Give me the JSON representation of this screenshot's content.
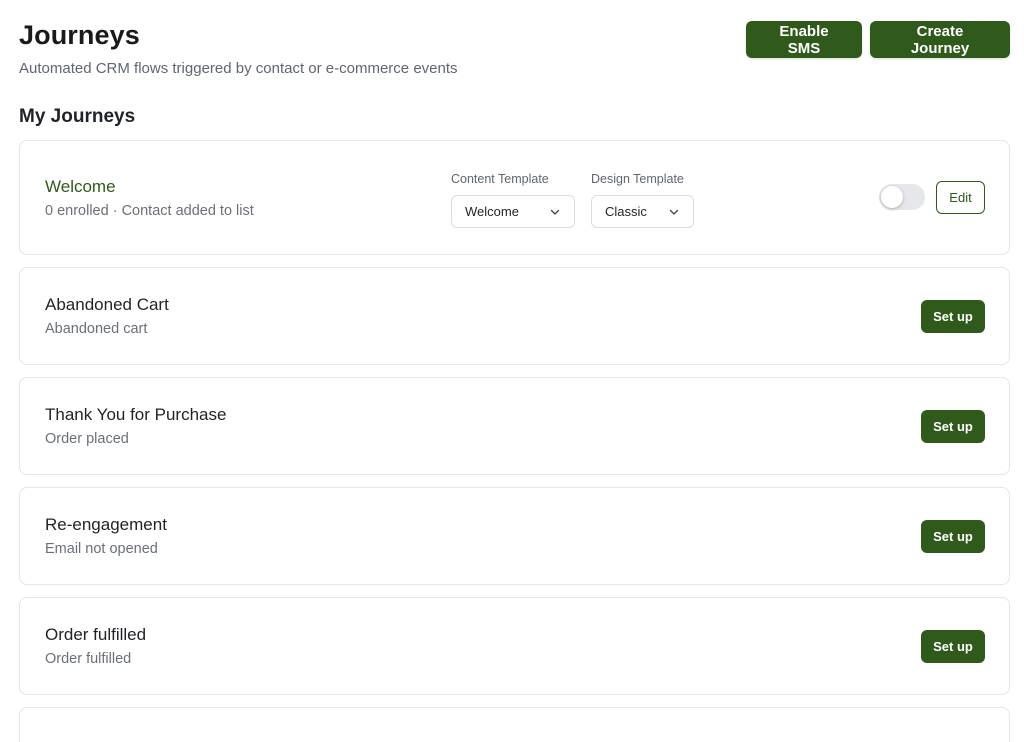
{
  "header": {
    "title": "Journeys",
    "subtitle": "Automated CRM flows triggered by contact or e-commerce events",
    "enable_sms_label": "Enable SMS",
    "create_journey_label": "Create Journey"
  },
  "section": {
    "title": "My Journeys"
  },
  "featured_journey": {
    "name": "Welcome",
    "description": "0 enrolled · Contact added to list",
    "content_template_label": "Content Template",
    "content_template_value": "Welcome",
    "design_template_label": "Design Template",
    "design_template_value": "Classic",
    "enabled": false,
    "edit_label": "Edit"
  },
  "journeys": [
    {
      "name": "Abandoned Cart",
      "trigger": "Abandoned cart",
      "action_label": "Set up"
    },
    {
      "name": "Thank You for Purchase",
      "trigger": "Order placed",
      "action_label": "Set up"
    },
    {
      "name": "Re-engagement",
      "trigger": "Email not opened",
      "action_label": "Set up"
    },
    {
      "name": "Order fulfilled",
      "trigger": "Order fulfilled",
      "action_label": "Set up"
    }
  ],
  "colors": {
    "brand": "#2f5a1c",
    "muted_text": "#6a7078",
    "border": "#e3e5e8",
    "toggle_off": "#e5e7ea"
  },
  "icons": {
    "select_caret": "chevron-down-icon"
  }
}
